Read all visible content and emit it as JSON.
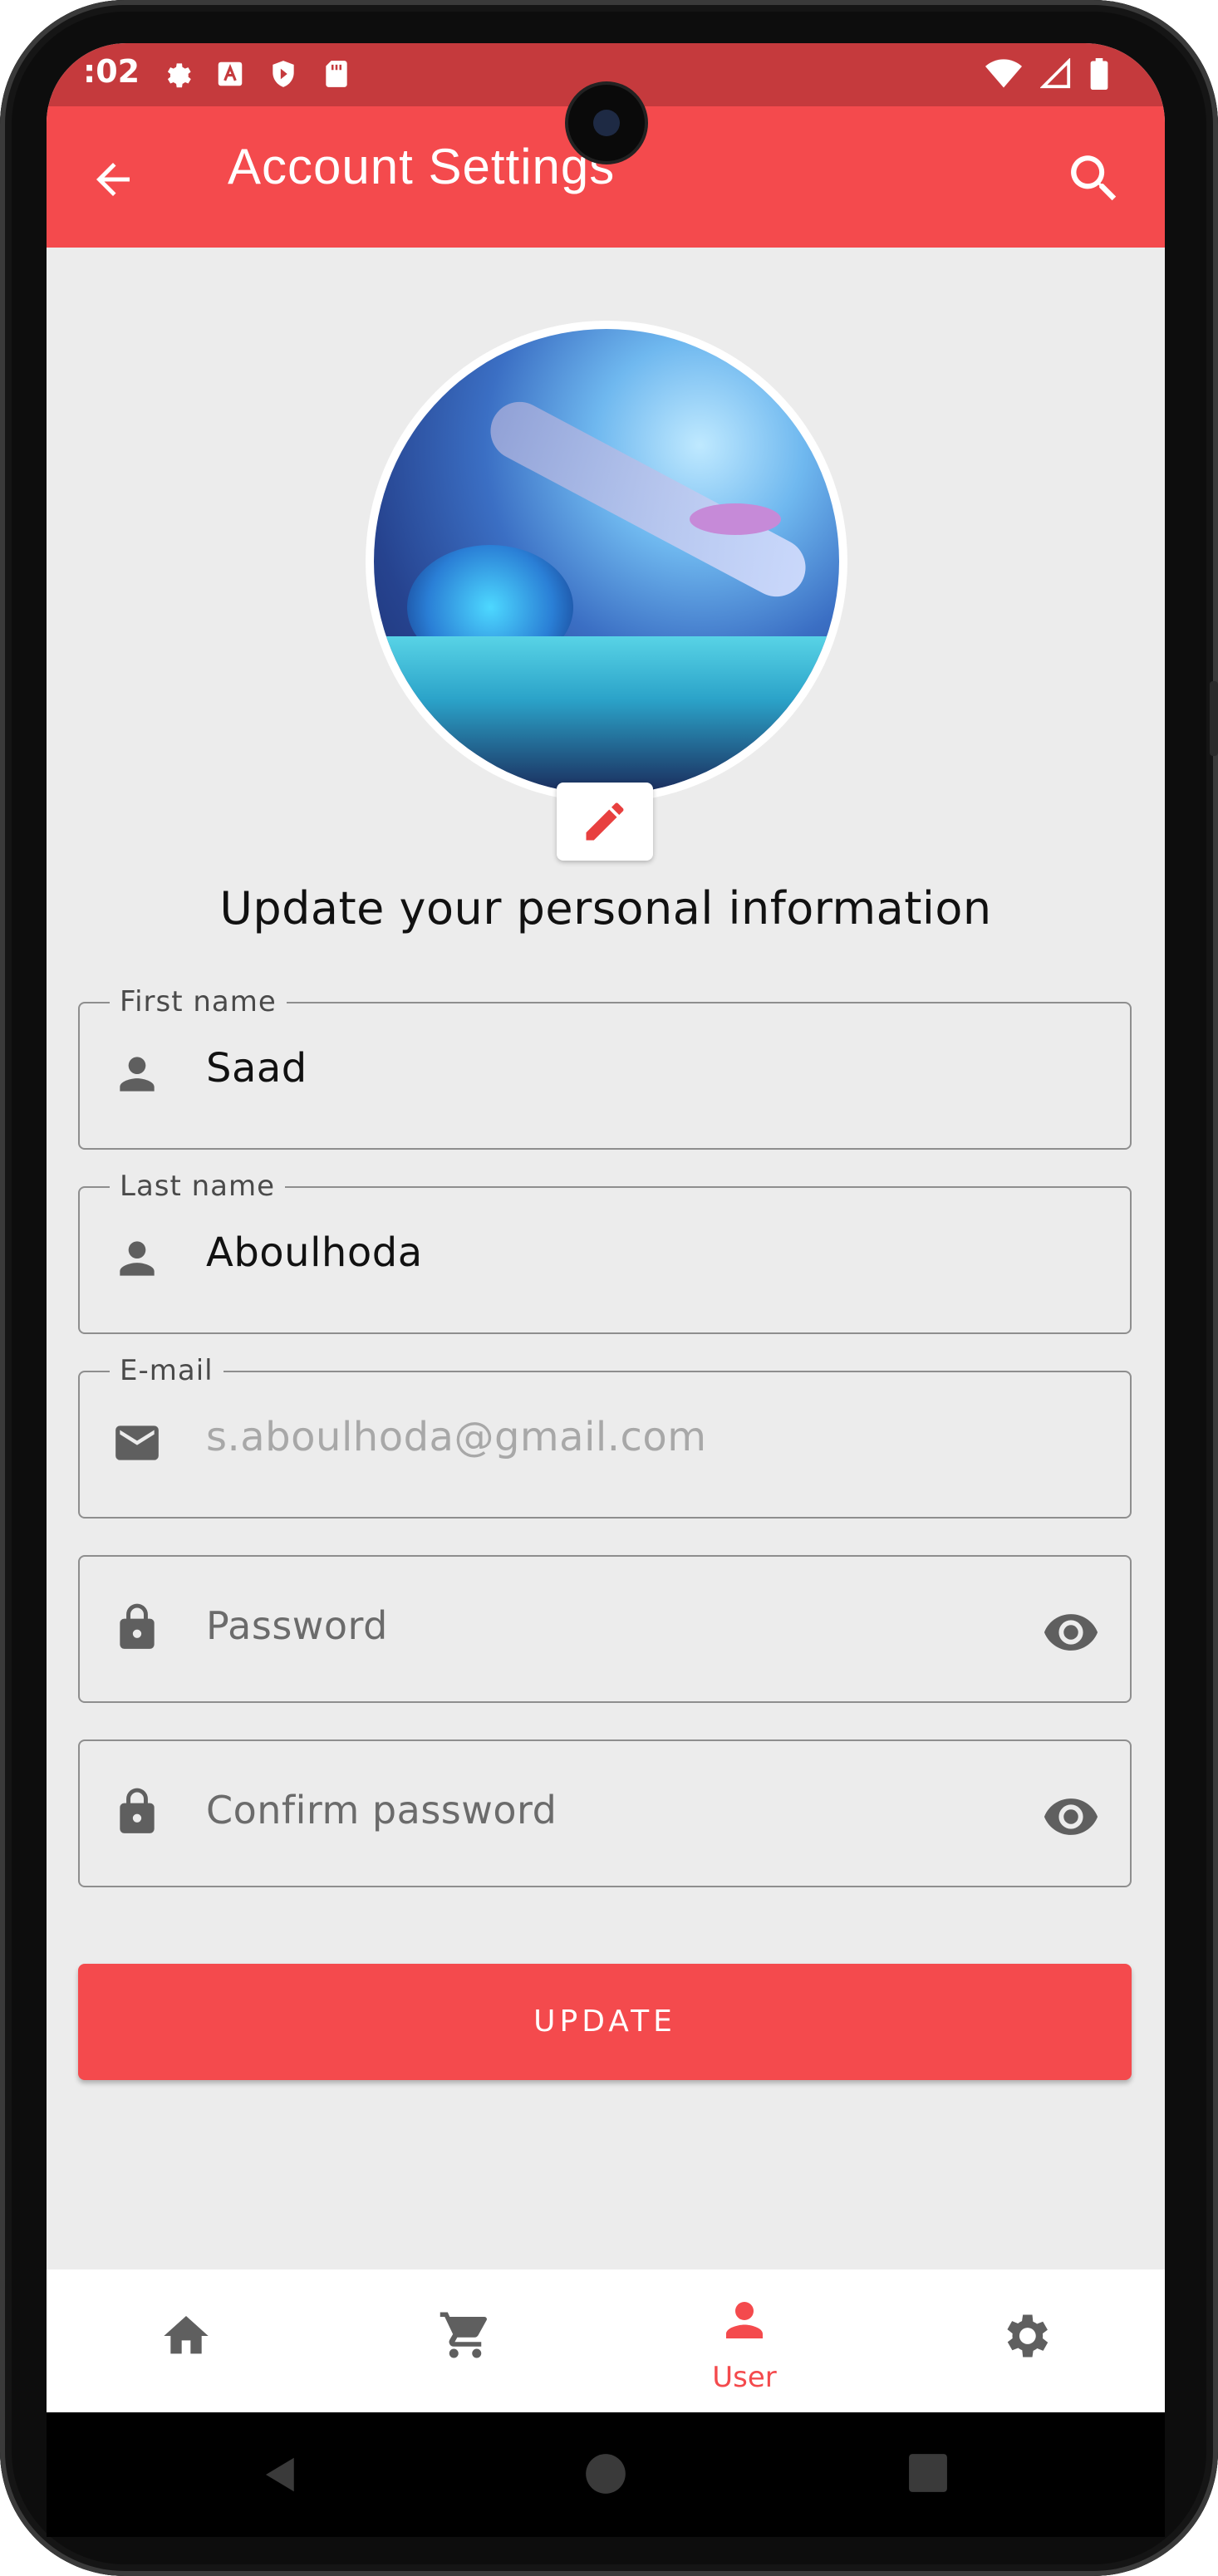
{
  "status_bar": {
    "time": ":02"
  },
  "app_bar": {
    "title": "Account Settings"
  },
  "profile": {
    "heading": "Update your personal information"
  },
  "form": {
    "first_name": {
      "label": "First name",
      "value": "Saad"
    },
    "last_name": {
      "label": "Last name",
      "value": "Aboulhoda"
    },
    "email": {
      "label": "E-mail",
      "value": "s.aboulhoda@gmail.com"
    },
    "password": {
      "placeholder": "Password"
    },
    "confirm_password": {
      "placeholder": "Confirm password"
    },
    "submit_label": "UPDATE"
  },
  "bottom_nav": {
    "items": [
      {
        "icon": "home-icon",
        "label": ""
      },
      {
        "icon": "cart-icon",
        "label": ""
      },
      {
        "icon": "user-icon",
        "label": "User",
        "active": true
      },
      {
        "icon": "gear-icon",
        "label": ""
      }
    ]
  },
  "colors": {
    "primary": "#f44a4d",
    "status_bar": "#c53a3d",
    "background": "#ececec"
  }
}
